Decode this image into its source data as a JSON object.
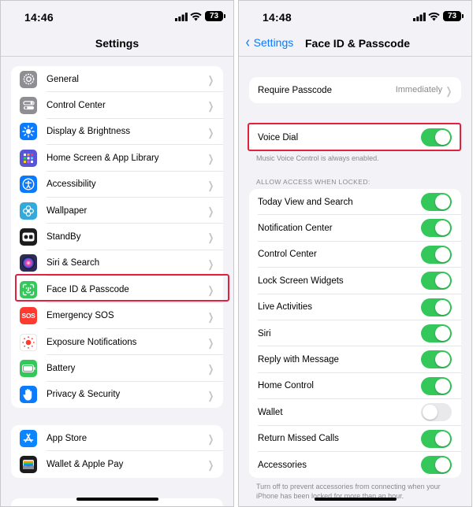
{
  "left": {
    "time": "14:46",
    "battery": "73",
    "title": "Settings",
    "group1": [
      {
        "label": "General",
        "icon": "gear-icon",
        "color": "#8e8e93"
      },
      {
        "label": "Control Center",
        "icon": "control-center-icon",
        "color": "#8e8e93"
      },
      {
        "label": "Display & Brightness",
        "icon": "sun-icon",
        "color": "#0a7aff"
      },
      {
        "label": "Home Screen & App Library",
        "icon": "home-grid-icon",
        "color": "#5856d6"
      },
      {
        "label": "Accessibility",
        "icon": "accessibility-icon",
        "color": "#0a7aff"
      },
      {
        "label": "Wallpaper",
        "icon": "flower-icon",
        "color": "#34aadc"
      },
      {
        "label": "StandBy",
        "icon": "standby-icon",
        "color": "#1c1c1e"
      },
      {
        "label": "Siri & Search",
        "icon": "siri-icon",
        "color": "#2c2c54"
      },
      {
        "label": "Face ID & Passcode",
        "icon": "face-id-icon",
        "color": "#34c759"
      },
      {
        "label": "Emergency SOS",
        "icon": "sos-icon",
        "color": "#ff3b30",
        "glyph": "SOS"
      },
      {
        "label": "Exposure Notifications",
        "icon": "exposure-icon",
        "color": "#ffffff"
      },
      {
        "label": "Battery",
        "icon": "battery-icon",
        "color": "#34c759"
      },
      {
        "label": "Privacy & Security",
        "icon": "hand-icon",
        "color": "#0a7aff"
      }
    ],
    "group2": [
      {
        "label": "App Store",
        "icon": "app-store-icon",
        "color": "#0a84ff"
      },
      {
        "label": "Wallet & Apple Pay",
        "icon": "wallet-icon",
        "color": "#1c1c1e"
      }
    ]
  },
  "right": {
    "time": "14:48",
    "battery": "73",
    "back_label": "Settings",
    "title": "Face ID & Passcode",
    "require_passcode": {
      "label": "Require Passcode",
      "value": "Immediately"
    },
    "voice_dial": {
      "label": "Voice Dial",
      "on": true
    },
    "voice_dial_footer": "Music Voice Control is always enabled.",
    "locked_header": "ALLOW ACCESS WHEN LOCKED:",
    "locked_items": [
      {
        "label": "Today View and Search",
        "on": true
      },
      {
        "label": "Notification Center",
        "on": true
      },
      {
        "label": "Control Center",
        "on": true
      },
      {
        "label": "Lock Screen Widgets",
        "on": true
      },
      {
        "label": "Live Activities",
        "on": true
      },
      {
        "label": "Siri",
        "on": true
      },
      {
        "label": "Reply with Message",
        "on": true
      },
      {
        "label": "Home Control",
        "on": true
      },
      {
        "label": "Wallet",
        "on": false
      },
      {
        "label": "Return Missed Calls",
        "on": true
      },
      {
        "label": "Accessories",
        "on": true
      }
    ],
    "locked_footer": "Turn off to prevent accessories from connecting when your iPhone has been locked for more than an hour."
  },
  "colors": {
    "accent": "#0a7aff",
    "toggle_on": "#34c759",
    "highlight": "#e0223f"
  }
}
